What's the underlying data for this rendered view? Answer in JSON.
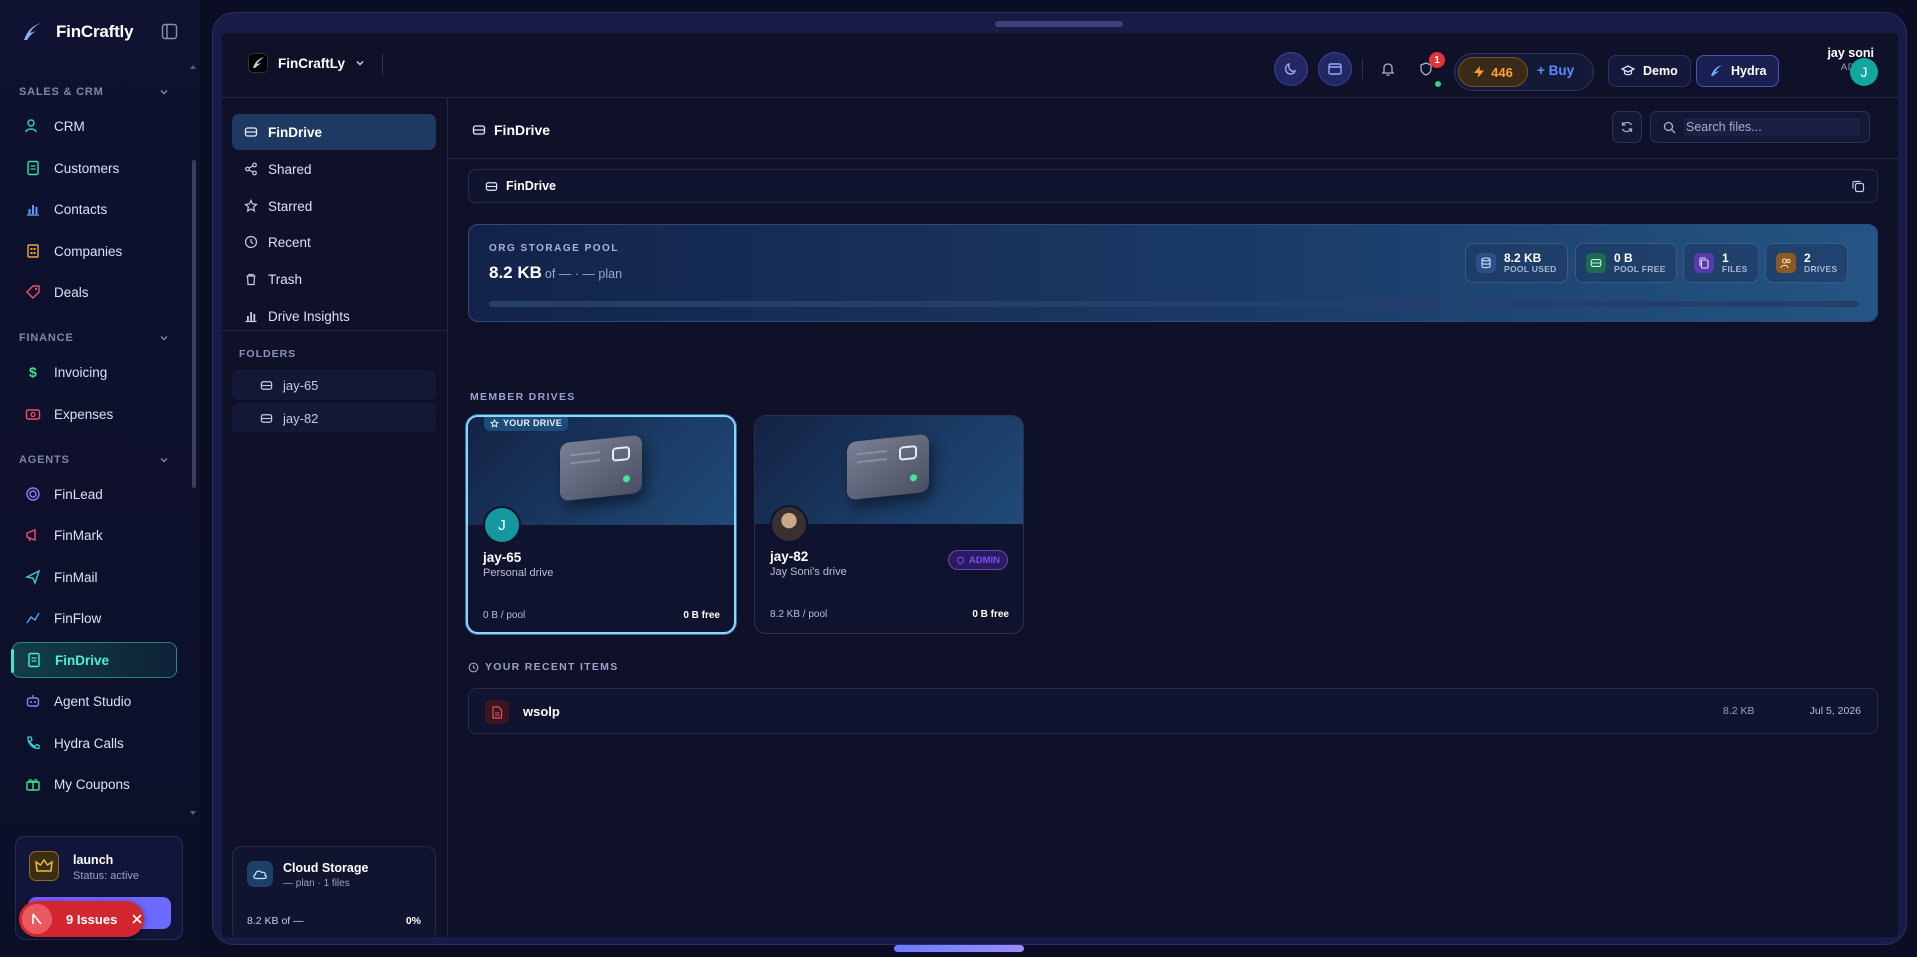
{
  "app": {
    "name": "FinCraftly"
  },
  "nav": {
    "sections": [
      {
        "title": "SALES & CRM"
      },
      {
        "title": "FINANCE"
      },
      {
        "title": "AGENTS"
      }
    ],
    "items": [
      {
        "label": "CRM",
        "icon": "users-icon"
      },
      {
        "label": "Customers",
        "icon": "document-icon"
      },
      {
        "label": "Contacts",
        "icon": "bar-chart-icon"
      },
      {
        "label": "Companies",
        "icon": "building-icon"
      },
      {
        "label": "Deals",
        "icon": "tag-icon"
      },
      {
        "label": "Invoicing",
        "icon": "dollar-icon"
      },
      {
        "label": "Expenses",
        "icon": "receipt-icon"
      },
      {
        "label": "FinLead",
        "icon": "target-icon"
      },
      {
        "label": "FinMark",
        "icon": "megaphone-icon"
      },
      {
        "label": "FinMail",
        "icon": "send-icon"
      },
      {
        "label": "FinFlow",
        "icon": "flow-icon"
      },
      {
        "label": "FinDrive",
        "icon": "file-icon"
      },
      {
        "label": "Agent Studio",
        "icon": "bot-icon"
      },
      {
        "label": "Hydra Calls",
        "icon": "phone-icon"
      },
      {
        "label": "My Coupons",
        "icon": "gift-icon"
      }
    ],
    "active": "FinDrive"
  },
  "plan": {
    "name": "launch",
    "status": "Status: active"
  },
  "issues": {
    "label": "9 Issues"
  },
  "topbar": {
    "org": "FinCraftLy",
    "credits": "446",
    "buy": "+ Buy",
    "demo": "Demo",
    "hydra": "Hydra",
    "notif_count": "1",
    "user_name": "jay soni",
    "user_role": "ADMIN",
    "avatar_letter": "J"
  },
  "drive_nav": {
    "items": [
      {
        "label": "FinDrive"
      },
      {
        "label": "Shared"
      },
      {
        "label": "Starred"
      },
      {
        "label": "Recent"
      },
      {
        "label": "Trash"
      },
      {
        "label": "Drive Insights"
      }
    ],
    "folders_title": "FOLDERS",
    "folders": [
      "jay-65",
      "jay-82"
    ]
  },
  "cloud": {
    "title": "Cloud Storage",
    "sub": "— plan · 1 files",
    "used": "8.2 KB of —",
    "pct": "0%"
  },
  "content": {
    "title": "FinDrive",
    "search_placeholder": "Search files...",
    "breadcrumb": "FinDrive"
  },
  "pool": {
    "label": "ORG STORAGE POOL",
    "used": "8.2 KB",
    "of": "of — · — plan",
    "used_fraction": 0,
    "stats": [
      {
        "value": "8.2 KB",
        "label": "POOL USED",
        "color": "#3b6fb8"
      },
      {
        "value": "0 B",
        "label": "POOL FREE",
        "color": "#1e8a6a"
      },
      {
        "value": "1",
        "label": "FILES",
        "color": "#7a4bd8"
      },
      {
        "value": "2",
        "label": "DRIVES",
        "color": "#b8742a"
      }
    ]
  },
  "member_drives": {
    "title": "MEMBER DRIVES",
    "your_drive_badge": "YOUR DRIVE",
    "drives": [
      {
        "name": "jay-65",
        "sub": "Personal drive",
        "used": "0 B / pool",
        "free": "0 B free",
        "avatar": "J"
      },
      {
        "name": "jay-82",
        "sub": "Jay Soni's drive",
        "used": "8.2 KB / pool",
        "free": "0 B free",
        "badge": "ADMIN"
      }
    ]
  },
  "recent": {
    "title": "YOUR RECENT ITEMS",
    "items": [
      {
        "name": "wsolp",
        "size": "8.2 KB",
        "date": "Jul 5, 2026"
      }
    ]
  }
}
